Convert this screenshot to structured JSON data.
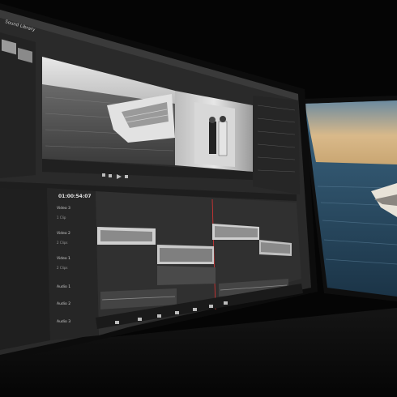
{
  "photo": {
    "subject": "dual-monitor video editing workstation",
    "timecode": "01:00:54:07",
    "tracks": {
      "video3": "Video 3",
      "video2": "Video 2",
      "video1": "Video 1",
      "audio1": "Audio 1",
      "audio2": "Audio 2",
      "audio3": "Audio 3",
      "clip_count_1": "1 Clip",
      "clip_count_2": "2 Clips"
    },
    "bin": {
      "sound_library": "Sound Library"
    },
    "colors": {
      "background": "#050505",
      "screen_ui": "#2a2a2a",
      "sea_right_monitor": "#2c4f6a",
      "sky_right_monitor": "#cfae7a"
    }
  }
}
